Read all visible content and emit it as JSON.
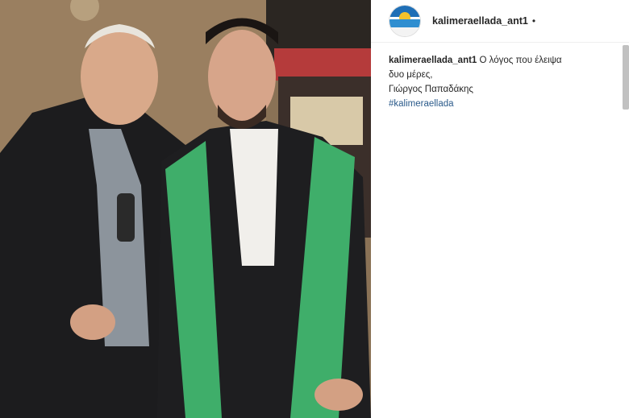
{
  "post": {
    "username": "kalimeraellada_ant1",
    "header_dot": "•",
    "caption_user": "kalimeraellada_ant1",
    "caption_line1": "Ο λόγος που έλειψα",
    "caption_line2": "δυο μέρες,",
    "caption_line3": "Γιώργος Παπαδάκης",
    "hashtag": "#kalimeraellada"
  },
  "colors": {
    "accent_hashtag": "#2a5a8a",
    "gown_green": "#3fae6a"
  }
}
